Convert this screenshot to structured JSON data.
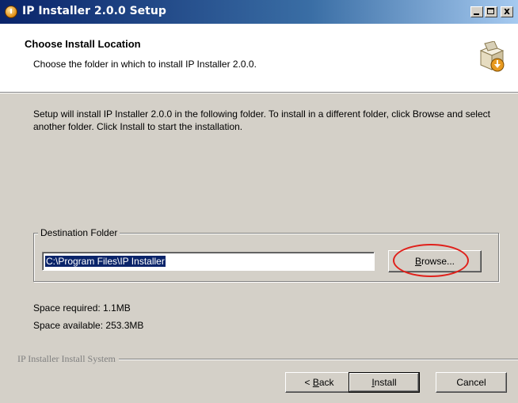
{
  "window": {
    "title": "IP Installer 2.0.0 Setup",
    "controls": {
      "minimize": "_",
      "maximize": "□",
      "close": "x"
    }
  },
  "header": {
    "title": "Choose Install Location",
    "subtitle": "Choose the folder in which to install IP Installer 2.0.0.",
    "icon": "installer-box-icon"
  },
  "body": {
    "description": "Setup will install IP Installer 2.0.0 in the following folder. To install in a different folder, click Browse and select another folder. Click Install to start the installation.",
    "destination": {
      "label": "Destination Folder",
      "path": "C:\\Program Files\\IP Installer",
      "browse_label_prefix": "B",
      "browse_label_rest": "rowse..."
    },
    "space_required": "Space required: 1.1MB",
    "space_available": "Space available: 253.3MB"
  },
  "footer": {
    "branding": "IP Installer Install System",
    "back_prefix": "< ",
    "back_hot": "B",
    "back_rest": "ack",
    "install_hot": "I",
    "install_rest": "nstall",
    "cancel_label": "Cancel"
  },
  "colors": {
    "titlebar_start": "#0a246a",
    "titlebar_end": "#a6caf0",
    "dialog_bg": "#d4d0c8",
    "selection": "#0a246a",
    "highlight_ring": "#e0201a"
  }
}
